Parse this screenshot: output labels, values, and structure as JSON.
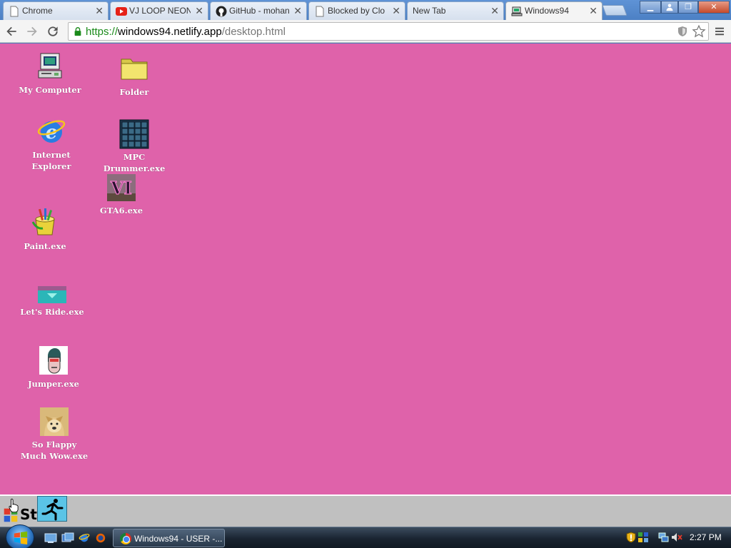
{
  "browser": {
    "tabs": [
      {
        "title": "Chrome",
        "favicon": "document-icon"
      },
      {
        "title": "VJ LOOP NEON",
        "favicon": "youtube-icon"
      },
      {
        "title": "GitHub - mohan",
        "favicon": "github-icon"
      },
      {
        "title": "Blocked by Clo",
        "favicon": "document-icon"
      },
      {
        "title": "New Tab",
        "favicon": "none"
      },
      {
        "title": "Windows94",
        "favicon": "computer-icon",
        "active": true
      }
    ],
    "close_glyph": "✕",
    "window_controls": {
      "minimize": "▁",
      "maximize": "❐",
      "close": "✕"
    },
    "url": {
      "scheme": "https://",
      "host": "windows94.netlify.app",
      "path": "/desktop.html"
    }
  },
  "desktop": {
    "background_color": "#df62aa",
    "icons": [
      {
        "label": "My Computer",
        "icon": "computer-icon"
      },
      {
        "label": "Folder",
        "icon": "folder-icon"
      },
      {
        "label": "Internet Explorer",
        "icon": "internet-explorer-icon"
      },
      {
        "label": "MPC Drummer.exe",
        "icon": "drum-pad-icon"
      },
      {
        "label": "GTA6.exe",
        "icon": "gta-vi-icon",
        "art_text": "VI"
      },
      {
        "label": "Paint.exe",
        "icon": "paint-bucket-icon"
      },
      {
        "label": "Let's Ride.exe",
        "icon": "lets-ride-icon"
      },
      {
        "label": "Jumper.exe",
        "icon": "jumper-icon"
      },
      {
        "label": "So Flappy Much Wow.exe",
        "icon": "doge-icon"
      }
    ]
  },
  "win94_taskbar": {
    "start_label": "St"
  },
  "win7_taskbar": {
    "task_button": "Windows94 - USER -...",
    "clock": "2:27 PM"
  }
}
